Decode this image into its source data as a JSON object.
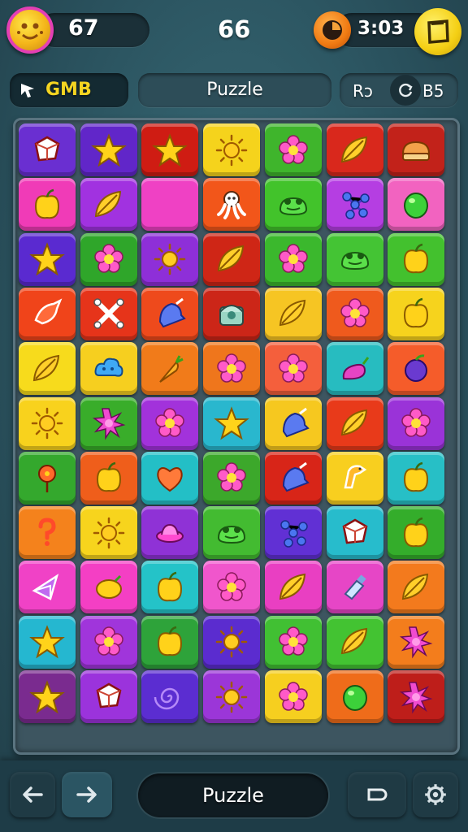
{
  "hud": {
    "coins": "67",
    "level": "66",
    "timer": "3:03"
  },
  "toolbar": {
    "game_label": "GMB",
    "mode_label": "Puzzle",
    "extra_label_left": "Rɔ",
    "extra_label_right": "B5"
  },
  "board": {
    "rows": 11,
    "cols": 7,
    "tiles": [
      [
        {
          "color": "#6a2fd1",
          "icon": "gem-icon"
        },
        {
          "color": "#6126c9",
          "icon": "star-icon"
        },
        {
          "color": "#cf1c13",
          "icon": "star-icon"
        },
        {
          "color": "#f5d31c",
          "icon": "sun-icon"
        },
        {
          "color": "#3fb52c",
          "icon": "flower-icon"
        },
        {
          "color": "#d9281c",
          "icon": "leaf-icon"
        },
        {
          "color": "#c2221a",
          "icon": "bread-icon"
        }
      ],
      [
        {
          "color": "#f03bb7",
          "icon": "apple-icon"
        },
        {
          "color": "#a132e0",
          "icon": "leaf-icon"
        },
        {
          "color": "#ef41c4",
          "icon": "blank-icon"
        },
        {
          "color": "#f2561a",
          "icon": "octopus-icon"
        },
        {
          "color": "#42c32b",
          "icon": "frog-icon"
        },
        {
          "color": "#b53ee2",
          "icon": "molecule-icon"
        },
        {
          "color": "#f263c0",
          "icon": "lime-icon"
        }
      ],
      [
        {
          "color": "#5a2ad0",
          "icon": "star-icon"
        },
        {
          "color": "#2fa62a",
          "icon": "flower-icon"
        },
        {
          "color": "#8e2fd8",
          "icon": "sun-icon"
        },
        {
          "color": "#cf2616",
          "icon": "leaf-icon"
        },
        {
          "color": "#3bb82d",
          "icon": "flower-icon"
        },
        {
          "color": "#44c434",
          "icon": "frog-icon"
        },
        {
          "color": "#43c12e",
          "icon": "apple-icon"
        }
      ],
      [
        {
          "color": "#f0441a",
          "icon": "bird-icon"
        },
        {
          "color": "#e6341a",
          "icon": "bone-icon"
        },
        {
          "color": "#ee4a1c",
          "icon": "bell-icon"
        },
        {
          "color": "#cc2618",
          "icon": "chest-icon"
        },
        {
          "color": "#f6c523",
          "icon": "leaf-icon"
        },
        {
          "color": "#ef5a1d",
          "icon": "flower-icon"
        },
        {
          "color": "#f6d31d",
          "icon": "apple-icon"
        }
      ],
      [
        {
          "color": "#f7db1c",
          "icon": "leaf-icon"
        },
        {
          "color": "#f6cf1f",
          "icon": "cloud-icon"
        },
        {
          "color": "#f17b1a",
          "icon": "carrot-icon"
        },
        {
          "color": "#ef761c",
          "icon": "flower-icon"
        },
        {
          "color": "#f45f3c",
          "icon": "flower-icon"
        },
        {
          "color": "#27bcc0",
          "icon": "pepper-icon"
        },
        {
          "color": "#f55c2a",
          "icon": "plum-icon"
        }
      ],
      [
        {
          "color": "#f8d21d",
          "icon": "sun-icon"
        },
        {
          "color": "#39ad2a",
          "icon": "burst-icon"
        },
        {
          "color": "#a232db",
          "icon": "flower-icon"
        },
        {
          "color": "#29b7ce",
          "icon": "star-icon"
        },
        {
          "color": "#f6c81f",
          "icon": "bell-icon"
        },
        {
          "color": "#e83a1a",
          "icon": "leaf-icon"
        },
        {
          "color": "#9a33d8",
          "icon": "flower-icon"
        }
      ],
      [
        {
          "color": "#34a82d",
          "icon": "balloon-icon"
        },
        {
          "color": "#ef5e1b",
          "icon": "apple-icon"
        },
        {
          "color": "#23bfc6",
          "icon": "heart-icon"
        },
        {
          "color": "#3ca82b",
          "icon": "flower-icon"
        },
        {
          "color": "#d82518",
          "icon": "bell-icon"
        },
        {
          "color": "#f8cf1f",
          "icon": "giraffe-icon"
        },
        {
          "color": "#27bfc6",
          "icon": "apple-icon"
        }
      ],
      [
        {
          "color": "#f4821c",
          "icon": "question-icon"
        },
        {
          "color": "#f7d41d",
          "icon": "sun-icon"
        },
        {
          "color": "#8f32d6",
          "icon": "ufo-icon"
        },
        {
          "color": "#43bb31",
          "icon": "frog-icon"
        },
        {
          "color": "#6130d4",
          "icon": "molecule-icon"
        },
        {
          "color": "#27bccc",
          "icon": "gem-icon"
        },
        {
          "color": "#34ad2b",
          "icon": "apple-icon"
        }
      ],
      [
        {
          "color": "#f042c6",
          "icon": "kite-icon"
        },
        {
          "color": "#f43fc4",
          "icon": "lemon-icon"
        },
        {
          "color": "#24c3c8",
          "icon": "apple-icon"
        },
        {
          "color": "#f056cc",
          "icon": "flower-icon"
        },
        {
          "color": "#e93fc2",
          "icon": "leaf-icon"
        },
        {
          "color": "#e646c6",
          "icon": "bottle-icon"
        },
        {
          "color": "#f37a1d",
          "icon": "leaf-icon"
        }
      ],
      [
        {
          "color": "#25b7d0",
          "icon": "star-icon"
        },
        {
          "color": "#a035db",
          "icon": "flower-icon"
        },
        {
          "color": "#2ea33a",
          "icon": "apple-icon"
        },
        {
          "color": "#5b2ccf",
          "icon": "sun-icon"
        },
        {
          "color": "#41c033",
          "icon": "flower-icon"
        },
        {
          "color": "#43c332",
          "icon": "leaf-icon"
        },
        {
          "color": "#f37d1c",
          "icon": "burst-icon"
        }
      ],
      [
        {
          "color": "#7a2b8f",
          "icon": "star-icon"
        },
        {
          "color": "#9b33dc",
          "icon": "gem-icon"
        },
        {
          "color": "#5b2dd1",
          "icon": "swirl-icon"
        },
        {
          "color": "#9b36d8",
          "icon": "sun-icon"
        },
        {
          "color": "#f6cf1f",
          "icon": "flower-icon"
        },
        {
          "color": "#ef6c1a",
          "icon": "lime-icon"
        },
        {
          "color": "#be1e1a",
          "icon": "burst-icon"
        }
      ]
    ]
  },
  "footer": {
    "title_label": "Puzzle"
  },
  "colors": {
    "background": "#2c5662",
    "panel": "#1b3038",
    "accent_yellow": "#f7d21e"
  }
}
